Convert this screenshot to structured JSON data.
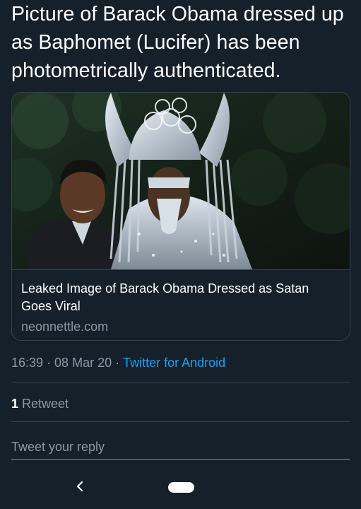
{
  "tweet": {
    "text": "Picture of Barack Obama dressed up as Baphomet (Lucifer) has been photometrically authenticated."
  },
  "card": {
    "image_icon": "photo-of-costumed-figure-in-tall-silver-horned-headdress-beside-smiling-man",
    "title": "Leaked Image of Barack Obama Dressed as Satan Goes Viral",
    "domain": "neonnettle.com"
  },
  "meta": {
    "time": "16:39",
    "date": "08 Mar 20",
    "source": "Twitter for Android",
    "separator": "·"
  },
  "stats": {
    "retweet_count": "1",
    "retweet_label": "Retweet"
  },
  "reply": {
    "placeholder": "Tweet your reply"
  },
  "navigation": {
    "back_icon": "chevron-left-icon",
    "home_icon": "home-pill-icon"
  },
  "colors": {
    "background": "#15202b",
    "text": "#ffffff",
    "secondary": "#8899a6",
    "link": "#1da1f2",
    "border": "#38444d"
  }
}
